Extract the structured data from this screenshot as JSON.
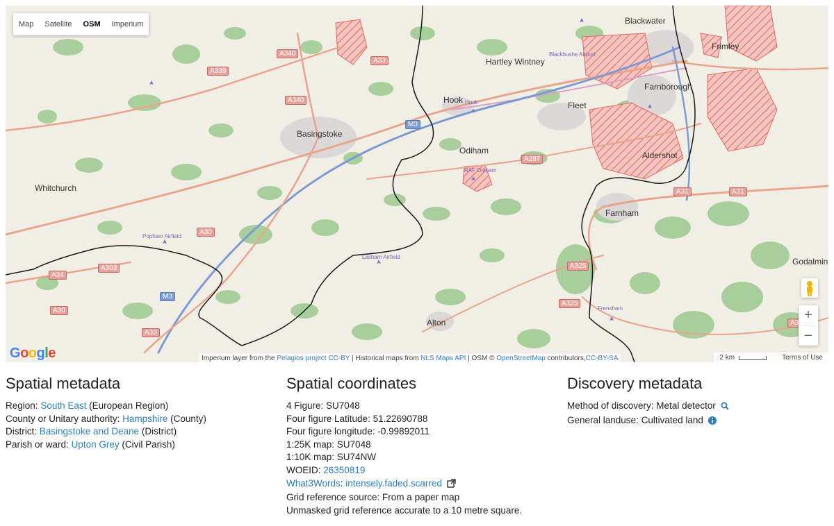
{
  "map": {
    "type_buttons": [
      "Map",
      "Satellite",
      "OSM",
      "Imperium"
    ],
    "active_type": "OSM",
    "google_logo": "Google",
    "attribution": {
      "prefix": "Imperium layer from the",
      "pelagios": "Pelagios project",
      "ccby1": "CC-BY",
      "hist": " | Historical maps from",
      "nls": "NLS Maps API",
      "osm_text": " | OSM ©",
      "osm": "OpenStreetMap",
      "contrib": "contributors,",
      "ccbysa": "CC-BY-SA"
    },
    "scale": "2 km",
    "terms": "Terms of Use",
    "zoom_in": "+",
    "zoom_out": "−",
    "places": [
      "Blackwater",
      "Frimley",
      "Hartley Wintney",
      "Hook",
      "Farnborough",
      "Fleet",
      "Basingstoke",
      "Odiham",
      "Aldershot",
      "Whitchurch",
      "Farnham",
      "Alton",
      "Godalmin",
      "Blackbushe Airport",
      "Hook",
      "RAF Odiham",
      "Popham Airfield",
      "Lasham Airfield",
      "Frensham"
    ],
    "roads": [
      "A340",
      "A33",
      "A339",
      "A340",
      "M3",
      "A287",
      "A31",
      "A31",
      "A30",
      "A303",
      "A34",
      "A30",
      "M3",
      "A33",
      "A325",
      "A325",
      "A3"
    ]
  },
  "spatial_metadata": {
    "heading": "Spatial metadata",
    "region_label": "Region:",
    "region_value": "South East",
    "region_suffix": "(European Region)",
    "county_label": "County or Unitary authority:",
    "county_value": "Hampshire",
    "county_suffix": "(County)",
    "district_label": "District:",
    "district_value": "Basingstoke and Deane",
    "district_suffix": "(District)",
    "parish_label": "Parish or ward:",
    "parish_value": "Upton Grey",
    "parish_suffix": "(Civil Parish)"
  },
  "spatial_coordinates": {
    "heading": "Spatial coordinates",
    "four_figure": "4 Figure: SU7048",
    "latitude": "Four figure Latitude: 51.22690788",
    "longitude": "Four figure longitude: -0.99892011",
    "map25k": "1:25K map: SU7048",
    "map10k": "1:10K map: SU74NW",
    "woeid_label": "WOEID:",
    "woeid_value": "26350819",
    "w3w_label": "What3Words",
    "w3w_value": "intensely.faded.scarred",
    "grid_source": "Grid reference source: From a paper map",
    "unmasked": "Unmasked grid reference accurate to a 10 metre square."
  },
  "discovery_metadata": {
    "heading": "Discovery metadata",
    "method": "Method of discovery: Metal detector",
    "landuse": "General landuse: Cultivated land"
  }
}
